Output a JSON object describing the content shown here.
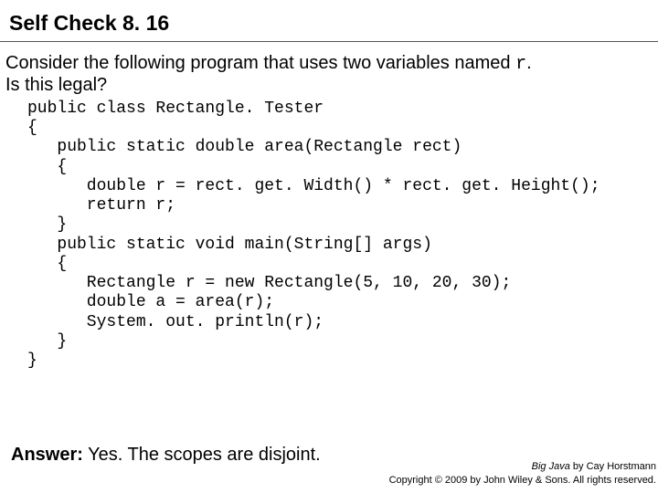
{
  "title": "Self Check 8. 16",
  "question": {
    "line1_pre": "Consider the following program that uses two variables named ",
    "line1_code": "r",
    "line1_post": ". ",
    "line2": "Is this legal?"
  },
  "code": "public class Rectangle. Tester\n{\n   public static double area(Rectangle rect)\n   {\n      double r = rect. get. Width() * rect. get. Height();\n      return r;\n   }\n   public static void main(String[] args)\n   {\n      Rectangle r = new Rectangle(5, 10, 20, 30);\n      double a = area(r);\n      System. out. println(r);\n   }\n}",
  "answer": {
    "label": "Answer:",
    "text": " Yes. The scopes are disjoint."
  },
  "attribution": {
    "book": "Big Java",
    "by": " by Cay Horstmann",
    "copyright": "Copyright © 2009 by John Wiley & Sons. All rights reserved."
  }
}
